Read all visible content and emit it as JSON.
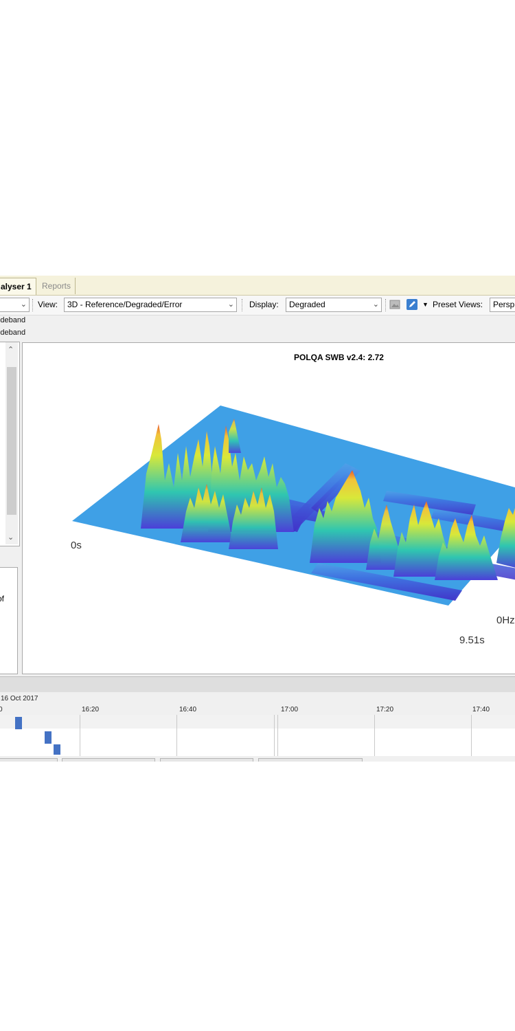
{
  "tabs": [
    {
      "label": "alyser 1",
      "active": true
    },
    {
      "label": "Reports",
      "active": false
    }
  ],
  "toolbar": {
    "view_label": "View:",
    "view_value": "3D - Reference/Degraded/Error",
    "display_label": "Display:",
    "display_value": "Degraded",
    "preset_label": "Preset Views:",
    "preset_value": "Persp",
    "icons": [
      "image-icon",
      "edit-icon",
      "dropdown-caret-icon"
    ]
  },
  "info_lines": [
    "wideband",
    "wideband"
  ],
  "left_panel_text": "of",
  "plot": {
    "title": "POLQA SWB v2.4: 2.72",
    "axis_start": "0s",
    "axis_end": "9.51s",
    "freq_label": "0Hz"
  },
  "timeline": {
    "date": "16 Oct 2017",
    "ticks": [
      "0",
      "16:20",
      "16:40",
      "17:00",
      "17:20",
      "17:40"
    ],
    "block_color": "#4472c4"
  },
  "colors": {
    "plane": "#3fa0e6",
    "peak_low": "#4b3fd8",
    "peak_mid": "#2fc6b0",
    "peak_high": "#f2e63b",
    "peak_top": "#e8572a"
  }
}
